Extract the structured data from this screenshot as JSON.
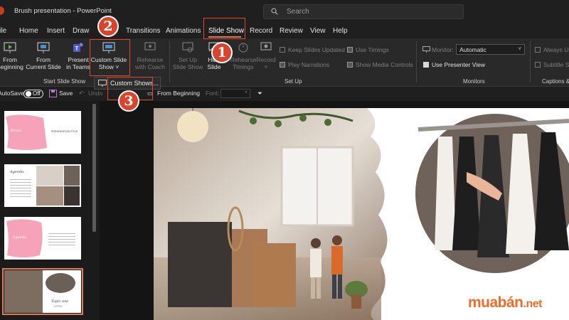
{
  "titlebar": {
    "title": "Brush presentation  -  PowerPoint",
    "search_placeholder": "Search"
  },
  "tabs": [
    {
      "label": "File"
    },
    {
      "label": "Home"
    },
    {
      "label": "Insert"
    },
    {
      "label": "Draw"
    },
    {
      "label": "Transitions"
    },
    {
      "label": "Animations"
    },
    {
      "label": "Slide Show"
    },
    {
      "label": "Record"
    },
    {
      "label": "Review"
    },
    {
      "label": "View"
    },
    {
      "label": "Help"
    }
  ],
  "ribbon": {
    "from_beginning": "From Beginning",
    "from_current": "From Current Slide",
    "present_teams": "Present in Teams",
    "custom_slide_show": "Custom Slide Show",
    "rehearse_coach": "Rehearse with Coach",
    "set_up": "Set Up Slide Show",
    "hide_slide": "Hide Slide",
    "rehearse_timings": "Rehearse Timings",
    "record": "Record",
    "keep_updated": "Keep Slides Updated",
    "use_timings": "Use Timings",
    "play_narrations": "Play Narrations",
    "show_media": "Show Media Controls",
    "monitor_label": "Monitor:",
    "monitor_value": "Automatic",
    "use_presenter": "Use Presenter View",
    "always_use": "Always Us",
    "subtitle_settings": "Subtitle S",
    "groups": {
      "start": "Start Slide Show",
      "setup": "Set Up",
      "monitors": "Monitors",
      "captions": "Captions &"
    }
  },
  "qat": {
    "autosave": "AutoSave",
    "toggle_state": "Off",
    "save": "Save",
    "undo": "Undo",
    "from_beginning": "From Beginning",
    "font": "Font:"
  },
  "dropdown": {
    "custom_shows": "Custom Shows..."
  },
  "annotations": {
    "step1": "1",
    "step2": "2",
    "step3": "3"
  },
  "thumbnails": {
    "t1_title": "Brush",
    "t1_sub": "PRESENTATION TITLE",
    "t2_title": "Agenda",
    "t3_title": "Agenda",
    "t4_title": "Topic one",
    "t4_sub": "LOTTA"
  },
  "watermark": {
    "brand": "muabán",
    "tld": ".net"
  },
  "colors": {
    "accent": "#e07a55",
    "annotation": "#d8442d",
    "brand_orange": "#ef6c28",
    "pink": "#f6a2b8"
  }
}
